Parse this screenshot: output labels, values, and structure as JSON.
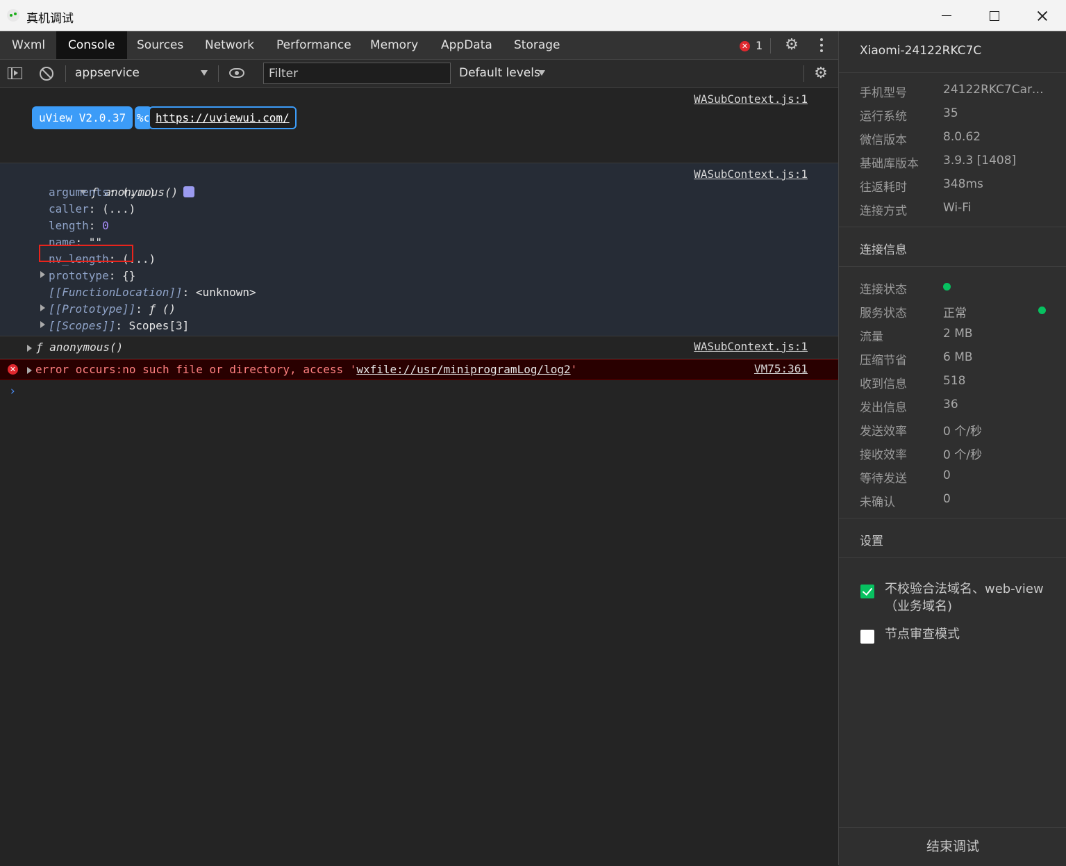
{
  "window": {
    "title": "真机调试"
  },
  "tabs": [
    {
      "label": "Wxml",
      "active": false
    },
    {
      "label": "Console",
      "active": true
    },
    {
      "label": "Sources",
      "active": false
    },
    {
      "label": "Network",
      "active": false
    },
    {
      "label": "Performance",
      "active": false
    },
    {
      "label": "Memory",
      "active": false
    },
    {
      "label": "AppData",
      "active": false
    },
    {
      "label": "Storage",
      "active": false
    }
  ],
  "error_count": "1",
  "toolbar": {
    "context": "appservice",
    "filter_placeholder": "Filter",
    "levels": "Default levels"
  },
  "console": {
    "msg1": {
      "source": "WASubContext.js:1",
      "badge_name": "uView V2.0.37",
      "badge_fmt": "%c",
      "badge_link": "https://uviewui.com/"
    },
    "msg2": {
      "source": "WASubContext.js:1",
      "f": "ƒ",
      "sig": "anonymous()",
      "props": [
        {
          "key": "arguments",
          "val": "(...)"
        },
        {
          "key": "caller",
          "val": "(...)"
        },
        {
          "key": "length",
          "val": "0"
        },
        {
          "key": "name",
          "val": "\"\""
        },
        {
          "key": "nv_length",
          "val": "(...)"
        },
        {
          "key": "prototype",
          "val": "{}"
        },
        {
          "key": "[[FunctionLocation]]",
          "val": "<unknown>"
        },
        {
          "key": "[[Prototype]]",
          "val": "ƒ ()"
        },
        {
          "key": "[[Scopes]]",
          "val": "Scopes[3]"
        }
      ]
    },
    "msg3": {
      "source": "WASubContext.js:1",
      "f": "ƒ",
      "sig": "anonymous()"
    },
    "msg4": {
      "source": "VM75:361",
      "text": "error occurs:no such file or directory, access '",
      "path": "wxfile://usr/miniprogramLog/log2",
      "tail": "'"
    },
    "prompt": "›"
  },
  "device": {
    "name": "Xiaomi-24122RKC7C",
    "info": [
      {
        "label": "手机型号",
        "value": "24122RKC7Carm..."
      },
      {
        "label": "运行系统",
        "value": "35"
      },
      {
        "label": "微信版本",
        "value": "8.0.62"
      },
      {
        "label": "基础库版本",
        "value": "3.9.3 [1408]"
      },
      {
        "label": "往返耗时",
        "value": "348ms"
      },
      {
        "label": "连接方式",
        "value": "Wi-Fi"
      }
    ],
    "conn_title": "连接信息",
    "conn": [
      {
        "label": "连接状态",
        "value": ""
      },
      {
        "label": "服务状态",
        "value": "正常"
      },
      {
        "label": "流量",
        "value": "2 MB"
      },
      {
        "label": "压缩节省",
        "value": "6 MB"
      },
      {
        "label": "收到信息",
        "value": "518"
      },
      {
        "label": "发出信息",
        "value": "36"
      },
      {
        "label": "发送效率",
        "value": "0 个/秒"
      },
      {
        "label": "接收效率",
        "value": "0 个/秒"
      },
      {
        "label": "等待发送",
        "value": "0"
      },
      {
        "label": "未确认",
        "value": "0"
      }
    ],
    "settings_title": "设置",
    "settings": [
      {
        "label": "不校验合法域名、web-view（业务域名)",
        "checked": true
      },
      {
        "label": "节点审查模式",
        "checked": false
      }
    ],
    "end_button": "结束调试"
  },
  "colors": {
    "accent": "#3c9cf8",
    "success": "#07c160",
    "error": "#e0282e"
  }
}
